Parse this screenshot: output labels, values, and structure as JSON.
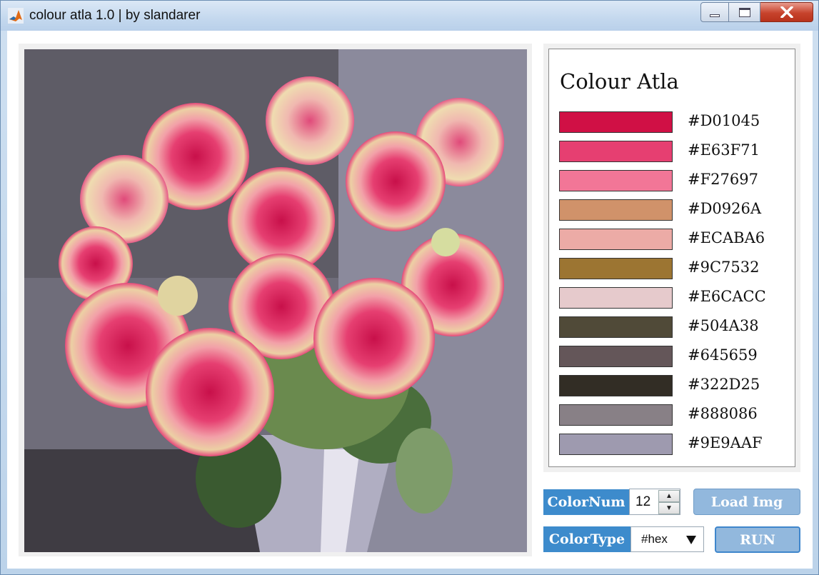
{
  "window": {
    "title": "colour atla 1.0 | by slandarer"
  },
  "atlas": {
    "title": "Colour Atla",
    "colors": [
      {
        "hex": "#D01045",
        "label": "#D01045"
      },
      {
        "hex": "#E63F71",
        "label": "#E63F71"
      },
      {
        "hex": "#F27697",
        "label": "#F27697"
      },
      {
        "hex": "#D0926A",
        "label": "#D0926A"
      },
      {
        "hex": "#ECABA6",
        "label": "#ECABA6"
      },
      {
        "hex": "#9C7532",
        "label": "#9C7532"
      },
      {
        "hex": "#E6CACC",
        "label": "#E6CACC"
      },
      {
        "hex": "#504A38",
        "label": "#504A38"
      },
      {
        "hex": "#645659",
        "label": "#645659"
      },
      {
        "hex": "#322D25",
        "label": "#322D25"
      },
      {
        "hex": "#888086",
        "label": "#888086"
      },
      {
        "hex": "#9E9AAF",
        "label": "#9E9AAF"
      }
    ]
  },
  "controls": {
    "color_num_label": "ColorNum",
    "color_num_value": "12",
    "color_type_label": "ColorType",
    "color_type_value": "#hex",
    "load_button": "Load Img",
    "run_button": "RUN"
  },
  "theme": {
    "accent": "#3D8BCC",
    "button_fill": "#92B8DD"
  }
}
